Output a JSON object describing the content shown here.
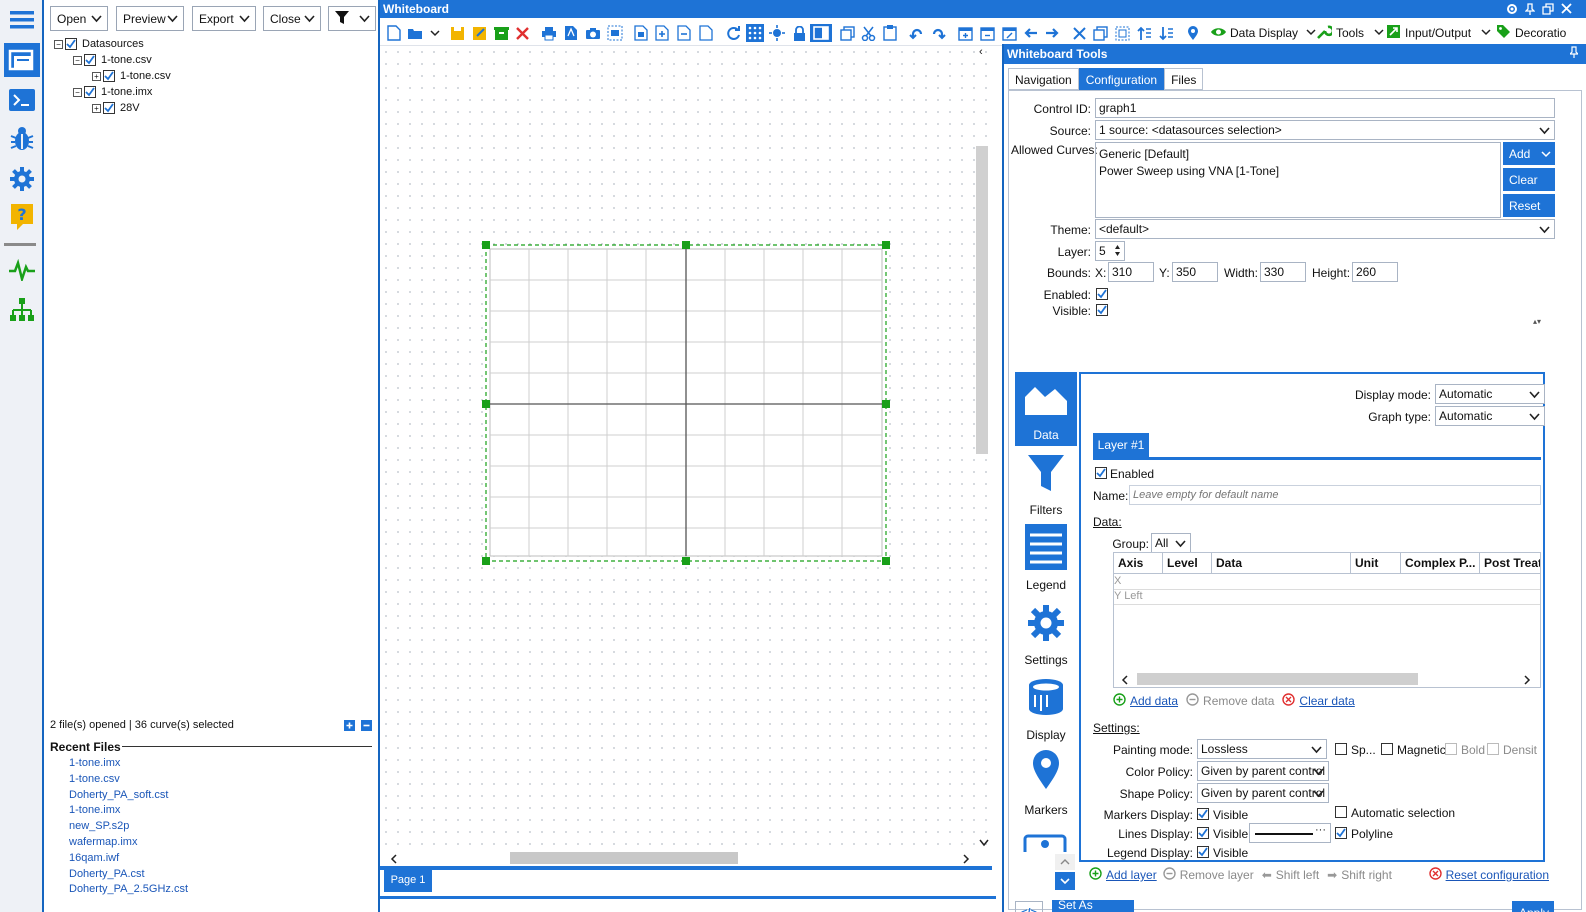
{
  "left_panel": {
    "toolbar": {
      "open": "Open",
      "preview": "Preview",
      "export": "Export",
      "close": "Close"
    },
    "tree": {
      "root": "Datasources",
      "items": [
        {
          "label": "1-tone.csv"
        },
        {
          "label": "1-tone.csv"
        },
        {
          "label": "1-tone.imx"
        },
        {
          "label": "28V"
        }
      ]
    },
    "status": "2 file(s) opened | 36 curve(s) selected",
    "recent_title": "Recent Files",
    "recent_files": [
      "1-tone.imx",
      "1-tone.csv",
      "Doherty_PA_soft.cst",
      "1-tone.imx",
      "new_SP.s2p",
      "wafermap.imx",
      "16qam.iwf",
      "Doherty_PA.cst",
      "Doherty_PA_2.5GHz.cst"
    ]
  },
  "whiteboard": {
    "title": "Whiteboard",
    "menus": {
      "data_display": "Data Display",
      "tools": "Tools",
      "input_output": "Input/Output",
      "decorations": "Decoratio"
    },
    "page_tab": "Page 1"
  },
  "tools_panel": {
    "title": "Whiteboard Tools",
    "tabs": [
      "Navigation",
      "Configuration",
      "Files"
    ],
    "control_id_label": "Control ID:",
    "control_id": "graph1",
    "source_label": "Source:",
    "source": "1 source: <datasources selection>",
    "allowed_curves_label": "Allowed Curves:",
    "allowed_curves": [
      "Generic [Default]",
      "Power Sweep using VNA [1-Tone]"
    ],
    "add_btn": "Add",
    "clear_btn": "Clear",
    "reset_btn": "Reset",
    "theme_label": "Theme:",
    "theme": "<default>",
    "layer_label": "Layer:",
    "layer": "5",
    "bounds_label": "Bounds:",
    "x_label": "X:",
    "bounds_x": "310",
    "y_label": "Y:",
    "bounds_y": "350",
    "width_label": "Width:",
    "bounds_width": "330",
    "height_label": "Height:",
    "bounds_height": "260",
    "enabled_label": "Enabled:",
    "visible_label": "Visible:",
    "side_nav": [
      "Data",
      "Filters",
      "Legend",
      "Settings",
      "Display",
      "Markers"
    ],
    "display_mode_label": "Display mode:",
    "display_mode": "Automatic",
    "graph_type_label": "Graph type:",
    "graph_type": "Automatic",
    "layer_tab": "Layer #1",
    "layer_enabled": "Enabled",
    "name_label": "Name:",
    "name_placeholder": "Leave empty for default name",
    "data_label": "Data:",
    "group_label": "Group:",
    "group": "All",
    "columns": [
      "Axis",
      "Level",
      "Data",
      "Unit",
      "Complex P...",
      "Post Treat"
    ],
    "rows": [
      "X",
      "Y Left"
    ],
    "add_data": "Add data",
    "remove_data": "Remove data",
    "clear_data": "Clear data",
    "settings_label": "Settings:",
    "painting_mode_label": "Painting mode:",
    "painting_mode": "Lossless",
    "sp_label": "Sp...",
    "magnetic_label": "Magnetic",
    "bold_label": "Bold",
    "density_label": "Densit",
    "color_policy_label": "Color Policy:",
    "color_policy": "Given by parent control",
    "shape_policy_label": "Shape Policy:",
    "shape_policy": "Given by parent control",
    "markers_display_label": "Markers Display:",
    "markers_visible": "Visible",
    "auto_selection": "Automatic selection",
    "lines_display_label": "Lines Display:",
    "lines_visible": "Visible:",
    "polyline": "Polyline",
    "legend_display_label": "Legend Display:",
    "legend_visible": "Visible",
    "add_layer": "Add layer",
    "remove_layer": "Remove layer",
    "shift_left": "Shift left",
    "shift_right": "Shift right",
    "reset_configuration": "Reset configuration",
    "set_as_default": "Set As Default",
    "apply": "Apply"
  },
  "colors": {
    "accent": "#1e73d6",
    "selection_handle": "#19a019",
    "link": "#1a56b8"
  }
}
